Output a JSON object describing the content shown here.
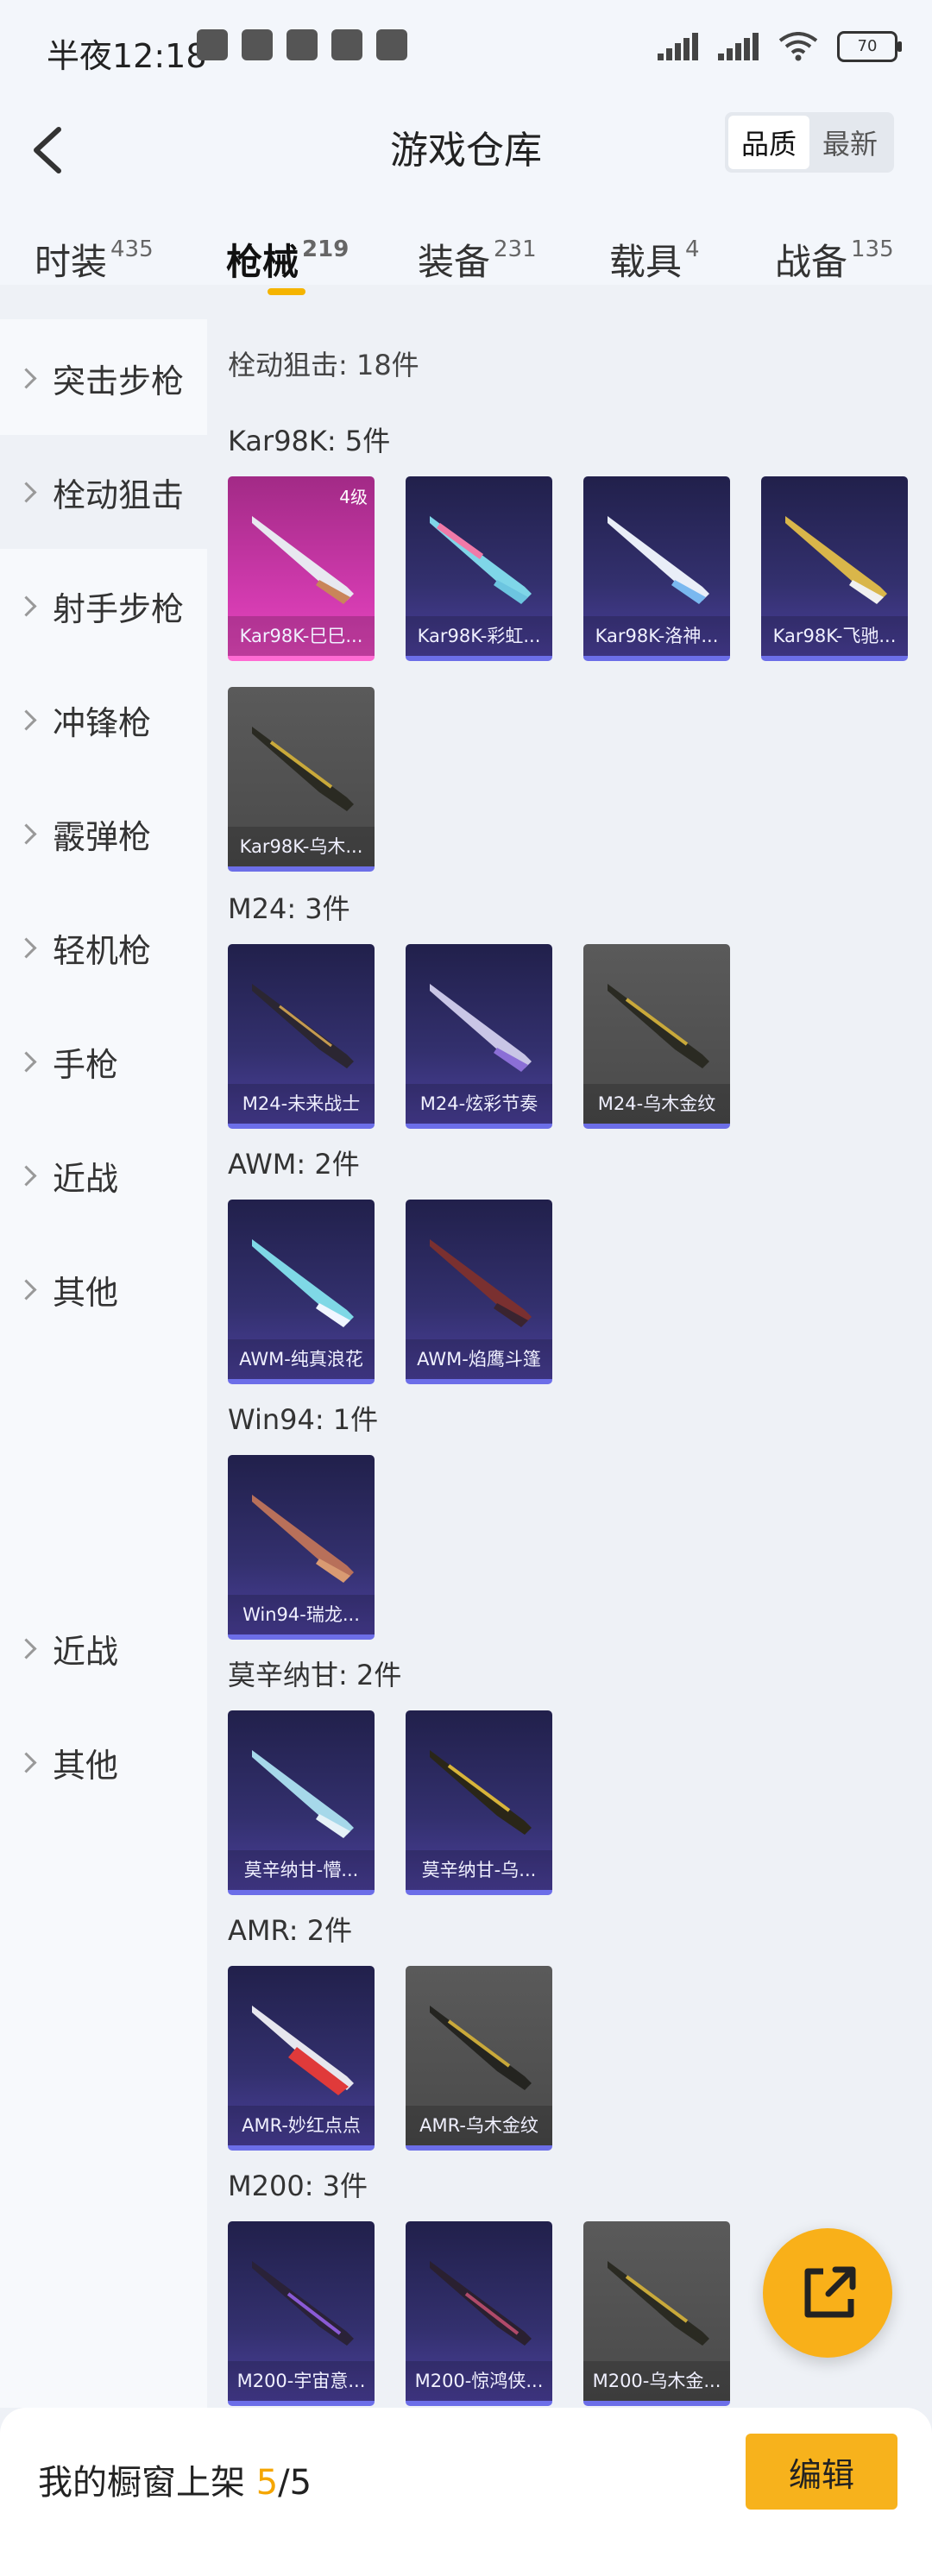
{
  "status_bar": {
    "time": "半夜12:18",
    "battery": "70"
  },
  "header": {
    "title": "游戏仓库",
    "sort_options": [
      "品质",
      "最新"
    ]
  },
  "tabs": [
    {
      "label": "时装",
      "count": "435"
    },
    {
      "label": "枪械",
      "count": "219"
    },
    {
      "label": "装备",
      "count": "231"
    },
    {
      "label": "载具",
      "count": "4"
    },
    {
      "label": "战备",
      "count": "135"
    }
  ],
  "sidebar": {
    "items": [
      "突击步枪",
      "栓动狙击",
      "射手步枪",
      "冲锋枪",
      "霰弹枪",
      "轻机枪",
      "手枪",
      "近战",
      "其他",
      "近战",
      "其他"
    ]
  },
  "content": {
    "summary": "栓动狙击: 18件",
    "groups": [
      {
        "label": "Kar98K: 5件",
        "items": [
          {
            "name": "Kar98K-巳巳...",
            "badge": "4级"
          },
          {
            "name": "Kar98K-彩虹..."
          },
          {
            "name": "Kar98K-洛神..."
          },
          {
            "name": "Kar98K-飞驰..."
          },
          {
            "name": "Kar98K-乌木..."
          }
        ]
      },
      {
        "label": "M24: 3件",
        "items": [
          {
            "name": "M24-未来战士"
          },
          {
            "name": "M24-炫彩节奏"
          },
          {
            "name": "M24-乌木金纹"
          }
        ]
      },
      {
        "label": "AWM: 2件",
        "items": [
          {
            "name": "AWM-纯真浪花"
          },
          {
            "name": "AWM-焰鹰斗篷"
          }
        ]
      },
      {
        "label": "Win94: 1件",
        "items": [
          {
            "name": "Win94-瑞龙..."
          }
        ]
      },
      {
        "label": "莫辛纳甘: 2件",
        "items": [
          {
            "name": "莫辛纳甘-懵..."
          },
          {
            "name": "莫辛纳甘-乌..."
          }
        ]
      },
      {
        "label": "AMR: 2件",
        "items": [
          {
            "name": "AMR-妙红点点"
          },
          {
            "name": "AMR-乌木金纹"
          }
        ]
      },
      {
        "label": "M200: 3件",
        "items": [
          {
            "name": "M200-宇宙意..."
          },
          {
            "name": "M200-惊鸿侠..."
          },
          {
            "name": "M200-乌木金..."
          }
        ]
      }
    ]
  },
  "footer": {
    "label": "我的橱窗上架",
    "current": "5",
    "separator": "/",
    "total": "5",
    "edit_label": "编辑"
  }
}
